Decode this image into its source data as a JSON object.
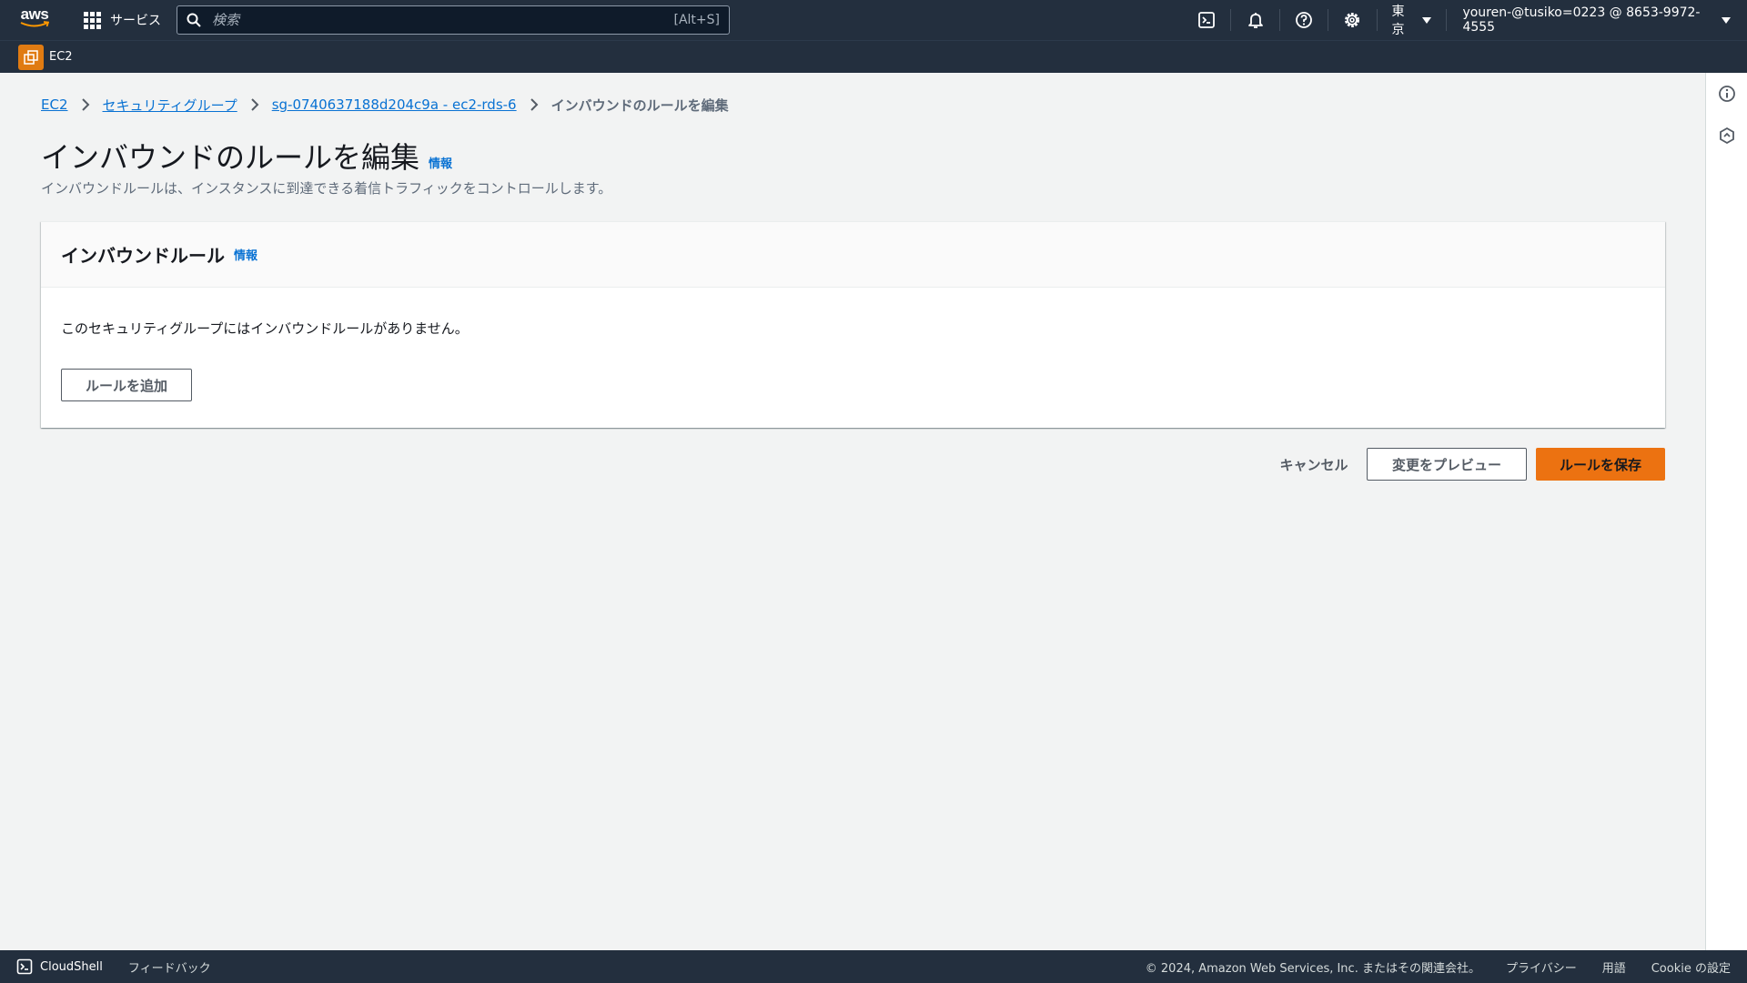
{
  "topnav": {
    "logo_text": "aws",
    "services_label": "サービス",
    "search_placeholder": "検索",
    "search_shortcut": "[Alt+S]",
    "region_label": "東京",
    "account_label": "youren-@tusiko=0223 @ 8653-9972-4555"
  },
  "subnav": {
    "service_name": "EC2"
  },
  "breadcrumb": {
    "items": [
      "EC2",
      "セキュリティグループ",
      "sg-0740637188d204c9a - ec2-rds-6"
    ],
    "current": "インバウンドのルールを編集"
  },
  "page": {
    "title": "インバウンドのルールを編集",
    "title_info": "情報",
    "description": "インバウンドルールは、インスタンスに到達できる着信トラフィックをコントロールします。"
  },
  "panel": {
    "title": "インバウンドルール",
    "title_info": "情報",
    "empty_text": "このセキュリティグループにはインバウンドルールがありません。",
    "add_rule_label": "ルールを追加"
  },
  "actions": {
    "cancel_label": "キャンセル",
    "preview_label": "変更をプレビュー",
    "save_label": "ルールを保存"
  },
  "footer": {
    "cloudshell_label": "CloudShell",
    "feedback_label": "フィードバック",
    "copyright": "© 2024, Amazon Web Services, Inc. またはその関連会社。",
    "privacy_label": "プライバシー",
    "terms_label": "用語",
    "cookie_label": "Cookie の設定"
  },
  "colors": {
    "nav_bg": "#232f3e",
    "accent_orange": "#ec7211",
    "link_blue": "#0972d3"
  }
}
